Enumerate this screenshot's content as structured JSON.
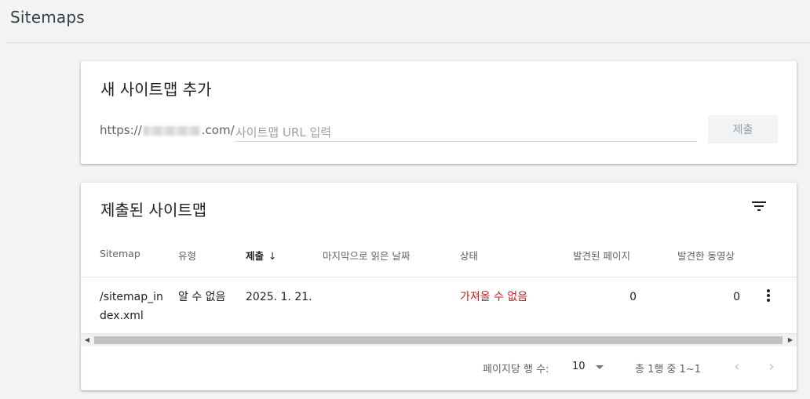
{
  "page": {
    "title": "Sitemaps"
  },
  "add_card": {
    "title": "새 사이트맵 추가",
    "url_prefix_start": "https://",
    "url_prefix_end": ".com/",
    "input_placeholder": "사이트맵 URL 입력",
    "input_value": "",
    "submit_label": "제출"
  },
  "list_card": {
    "title": "제출된 사이트맵",
    "filter_icon": "filter-icon",
    "columns": {
      "sitemap": "Sitemap",
      "type": "유형",
      "submitted": "제출",
      "last_read": "마지막으로 읽은 날짜",
      "status": "상태",
      "pages": "발견된 페이지",
      "videos": "발견한 동영상"
    },
    "sort_indicator": "↓",
    "rows": [
      {
        "sitemap": "/sitemap_index.xml",
        "type": "알 수 없음",
        "submitted": "2025. 1. 21.",
        "last_read": "",
        "status": "가져올 수 없음",
        "pages": "0",
        "videos": "0"
      }
    ],
    "pagination": {
      "rows_per_page_label": "페이지당 행 수:",
      "rows_per_page_value": "10",
      "range_label": "총 1행 중 1~1"
    },
    "colors": {
      "error_status": "#c5221f"
    }
  }
}
